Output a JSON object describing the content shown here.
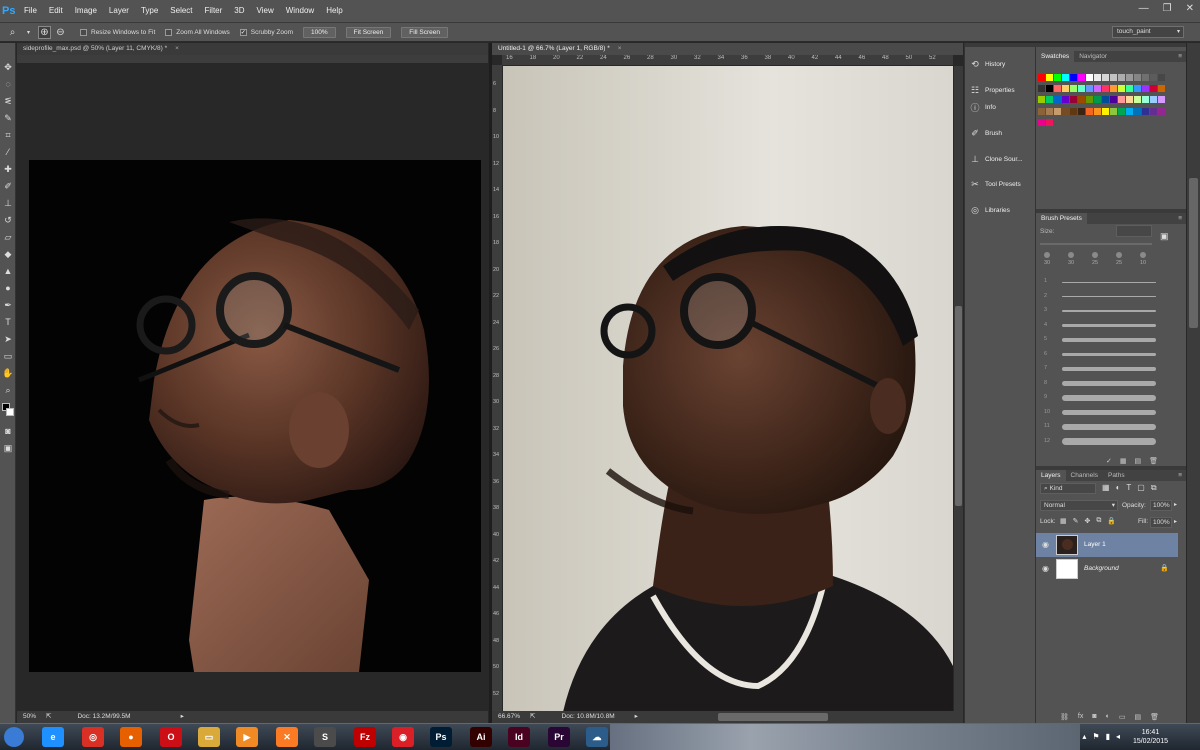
{
  "app": {
    "logo": "Ps"
  },
  "menu": [
    "File",
    "Edit",
    "Image",
    "Layer",
    "Type",
    "Select",
    "Filter",
    "3D",
    "View",
    "Window",
    "Help"
  ],
  "window_controls": {
    "minimize": "—",
    "restore": "❐",
    "close": "✕"
  },
  "options": {
    "resize_windows_label": "Resize Windows to Fit",
    "zoom_all_label": "Zoom All Windows",
    "scrubby_zoom_label": "Scrubby Zoom",
    "zoom_100_label": "100%",
    "fit_screen_label": "Fit Screen",
    "fill_screen_label": "Fill Screen",
    "workspace_value": "touch_paint"
  },
  "doc1": {
    "tab_title": "sideprofile_max.psd @ 50% (Layer 11, CMYK/8) *",
    "zoom": "50%",
    "doc_size": "Doc: 13.2M/99.5M"
  },
  "doc2": {
    "tab_title": "Untitled-1 @ 66.7% (Layer 1, RGB/8) *",
    "zoom": "66.67%",
    "doc_size": "Doc: 10.8M/10.8M",
    "ruler_top": [
      "16",
      "18",
      "20",
      "22",
      "24",
      "26",
      "28",
      "30",
      "32",
      "34",
      "36",
      "38",
      "40",
      "42",
      "44",
      "46",
      "48",
      "50",
      "52"
    ],
    "ruler_left": [
      "6",
      "8",
      "10",
      "12",
      "14",
      "16",
      "18",
      "20",
      "22",
      "24",
      "26",
      "28",
      "30",
      "32",
      "34",
      "36",
      "38",
      "40",
      "42",
      "44",
      "46",
      "48",
      "50",
      "52"
    ]
  },
  "dock": {
    "items": [
      "History",
      "Properties",
      "Info",
      "Brush",
      "Clone Sour...",
      "Tool Presets",
      "Libraries"
    ]
  },
  "swatches": {
    "tabs": [
      "Swatches",
      "Navigator"
    ],
    "colors": [
      "#ff0000",
      "#ffff00",
      "#00ff00",
      "#00ffff",
      "#0000ff",
      "#ff00ff",
      "#ffffff",
      "#ebebeb",
      "#d6d6d6",
      "#c2c2c2",
      "#adadad",
      "#999999",
      "#858585",
      "#707070",
      "#5c5c5c",
      "#474747",
      "#333333",
      "#000000",
      "#ff6666",
      "#ffcc66",
      "#99ff66",
      "#66ffcc",
      "#6699ff",
      "#cc66ff",
      "#ff3366",
      "#ff9933",
      "#ccff33",
      "#33ff99",
      "#3399ff",
      "#9933ff",
      "#cc0033",
      "#cc6600",
      "#99cc00",
      "#00cc66",
      "#0066cc",
      "#6600cc",
      "#990033",
      "#994c00",
      "#669900",
      "#00994c",
      "#004c99",
      "#4c0099",
      "#ff9999",
      "#ffd699",
      "#ccff99",
      "#99ffd6",
      "#99ccff",
      "#d699ff",
      "#8c6239",
      "#a67c52",
      "#c69c6d",
      "#754c24",
      "#603913",
      "#3c2415",
      "#f26522",
      "#f7941d",
      "#fff200",
      "#8dc63f",
      "#00a651",
      "#00aeef",
      "#0072bc",
      "#2e3192",
      "#662d91",
      "#92278f",
      "#ec008c",
      "#ed145b"
    ]
  },
  "brush_presets": {
    "tab": "Brush Presets",
    "size_label": "Size:",
    "tip_sizes": [
      "30",
      "30",
      "25",
      "25",
      "10"
    ],
    "stroke_numbers": [
      "1",
      "2",
      "3",
      "4",
      "5",
      "6",
      "7",
      "8",
      "9",
      "10",
      "11",
      "12"
    ]
  },
  "layers": {
    "tabs": [
      "Layers",
      "Channels",
      "Paths"
    ],
    "kind_label": "Kind",
    "blend_mode": "Normal",
    "opacity_label": "Opacity:",
    "opacity_value": "100%",
    "lock_label": "Lock:",
    "fill_label": "Fill:",
    "fill_value": "100%",
    "items": [
      {
        "name": "Layer 1"
      },
      {
        "name": "Background"
      }
    ]
  },
  "taskbar": {
    "icons": [
      {
        "name": "start-orb-icon",
        "glyph": "",
        "color": "#3a7bd5"
      },
      {
        "name": "ie-icon",
        "glyph": "e",
        "color": "#1e90ff"
      },
      {
        "name": "chrome-icon",
        "glyph": "◎",
        "color": "#d93025"
      },
      {
        "name": "firefox-icon",
        "glyph": "●",
        "color": "#e66000"
      },
      {
        "name": "opera-icon",
        "glyph": "O",
        "color": "#cc0f16"
      },
      {
        "name": "folder-icon",
        "glyph": "▭",
        "color": "#d9a93a"
      },
      {
        "name": "media-player-icon",
        "glyph": "▶",
        "color": "#f08a24"
      },
      {
        "name": "xampp-icon",
        "glyph": "✕",
        "color": "#fb7a24"
      },
      {
        "name": "sublime-icon",
        "glyph": "S",
        "color": "#4b4b4b"
      },
      {
        "name": "filezilla-icon",
        "glyph": "Fz",
        "color": "#bf0000"
      },
      {
        "name": "creative-cloud-icon",
        "glyph": "◉",
        "color": "#da1f26"
      },
      {
        "name": "photoshop-icon",
        "glyph": "Ps",
        "color": "#001d34"
      },
      {
        "name": "illustrator-icon",
        "glyph": "Ai",
        "color": "#330000"
      },
      {
        "name": "indesign-icon",
        "glyph": "Id",
        "color": "#49021f"
      },
      {
        "name": "premiere-icon",
        "glyph": "Pr",
        "color": "#2a0634"
      },
      {
        "name": "network-app-icon",
        "glyph": "☁",
        "color": "#2c5d8a"
      }
    ],
    "time": "16:41",
    "date": "15/02/2015"
  }
}
